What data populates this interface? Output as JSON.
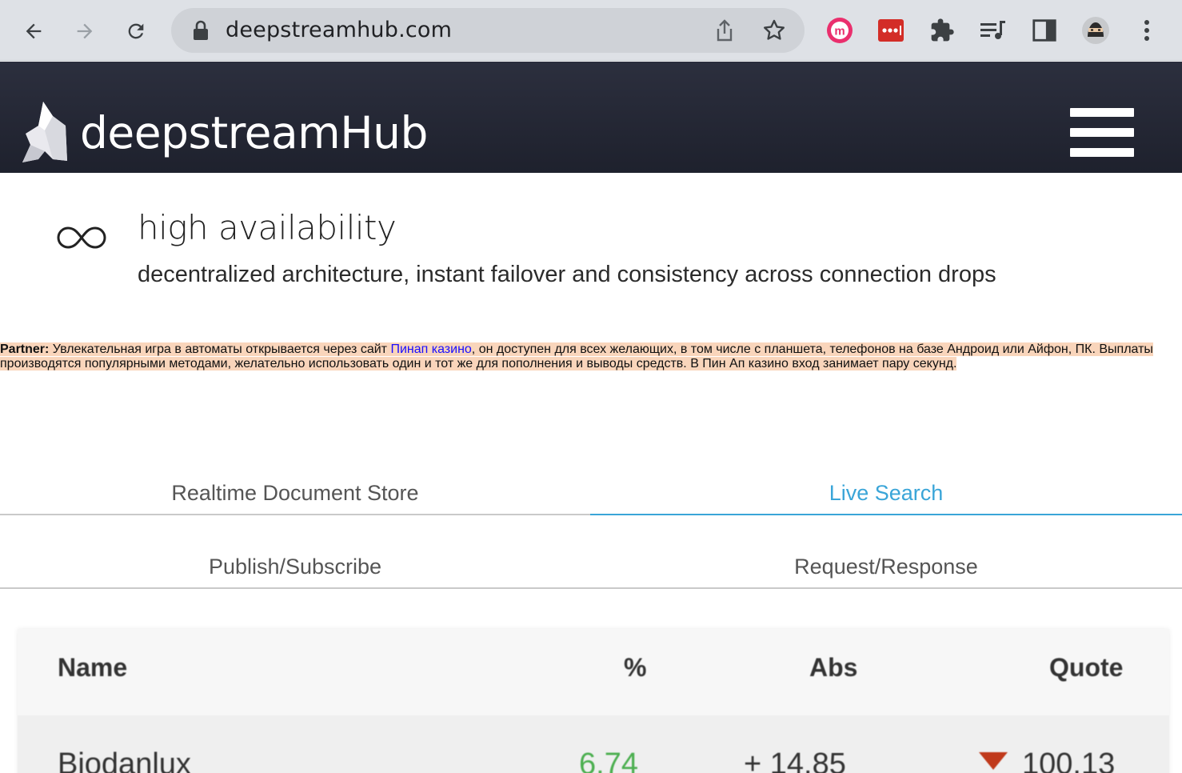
{
  "browser": {
    "url": "deepstreamhub.com",
    "icons": {
      "back": "back-arrow-icon",
      "forward": "forward-arrow-icon",
      "reload": "reload-icon",
      "lock": "lock-icon",
      "share": "share-icon",
      "bookmark": "star-icon",
      "extensions": [
        "m-extension-icon",
        "lastpass-extension-icon",
        "puzzle-extensions-icon",
        "media-queue-icon",
        "side-panel-icon",
        "profile-avatar-icon",
        "kebab-menu-icon"
      ]
    }
  },
  "header": {
    "brand": "deepstreamHub",
    "menu_icon": "hamburger-icon",
    "colors": {
      "background": "#25283a"
    }
  },
  "feature": {
    "icon": "infinity-icon",
    "title": "high availability",
    "description": "decentralized architecture, instant failover and consistency across connection drops"
  },
  "partner": {
    "label": "Partner:",
    "text_before": " Увлекательная игра в автоматы открывается через сайт ",
    "link_text": "Пинап казино",
    "text_after": ", он доступен для всех желающих, в том числе с планшета, телефонов на базе Андроид или Айфон, ПК. Выплаты производятся популярными методами, желательно использовать один и тот же для пополнения и выводы средств. В Пин Ап казино вход занимает пару секунд."
  },
  "tabs": {
    "items": [
      {
        "label": "Realtime Document Store",
        "active": false
      },
      {
        "label": "Live Search",
        "active": true
      },
      {
        "label": "Publish/Subscribe",
        "active": false
      },
      {
        "label": "Request/Response",
        "active": false
      }
    ],
    "colors": {
      "active": "#3aa5d8",
      "inactive": "#555555"
    }
  },
  "table": {
    "columns": [
      "Name",
      "%",
      "Abs",
      "Quote"
    ],
    "rows": [
      {
        "name": "Biodanlux",
        "pct": "6.74",
        "abs": "+ 14.85",
        "quote": "100.13",
        "trend_icon": "down-triangle-icon"
      }
    ],
    "colors": {
      "positive": "#4caf50",
      "down": "#c0391b"
    }
  }
}
